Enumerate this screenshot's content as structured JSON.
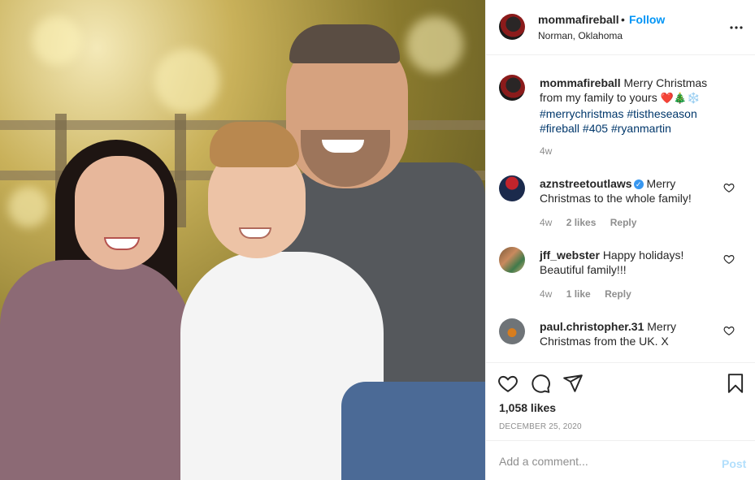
{
  "post": {
    "image_alt": "Family photo",
    "header": {
      "username": "mommafireball",
      "separator": "•",
      "follow_label": "Follow",
      "location": "Norman, Oklahoma",
      "more_icon": "ellipsis-icon"
    },
    "caption": {
      "username": "mommafireball",
      "text": "Merry Christmas from my family to yours",
      "emojis": "❤️🎄❄️",
      "hashtags": [
        "#merrychristmas",
        "#tistheseason",
        "#fireball",
        "#405",
        "#ryanmartin"
      ],
      "time": "4w"
    },
    "comments": [
      {
        "username": "aznstreetoutlaws",
        "verified": true,
        "text": "Merry Christmas to the whole family!",
        "time": "4w",
        "likes": "2 likes",
        "reply_label": "Reply"
      },
      {
        "username": "jff_webster",
        "verified": false,
        "text": "Happy holidays! Beautiful family!!!",
        "time": "4w",
        "likes": "1 like",
        "reply_label": "Reply"
      },
      {
        "username": "paul.christopher.31",
        "verified": false,
        "text": "Merry Christmas from the UK. X"
      }
    ],
    "actions": {
      "like_icon": "heart-icon",
      "comment_icon": "comment-icon",
      "share_icon": "paper-plane-icon",
      "save_icon": "bookmark-icon"
    },
    "likes_count": "1,058 likes",
    "date": "DECEMBER 25, 2020",
    "add_comment": {
      "placeholder": "Add a comment...",
      "post_label": "Post"
    }
  },
  "colors": {
    "follow": "#0095f6",
    "hashtag": "#00376b",
    "muted": "#8e8e8e",
    "post_disabled": "#b2dffc",
    "verified": "#3897f0"
  }
}
